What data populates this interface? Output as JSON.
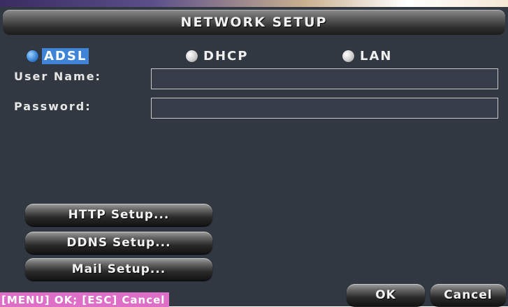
{
  "dialog": {
    "title": "NETWORK SETUP"
  },
  "connection_types": [
    {
      "label": "ADSL",
      "selected": true
    },
    {
      "label": "DHCP",
      "selected": false
    },
    {
      "label": "LAN",
      "selected": false
    }
  ],
  "fields": {
    "username": {
      "label": "User Name:",
      "value": ""
    },
    "password": {
      "label": "Password:",
      "value": ""
    }
  },
  "buttons": {
    "http": "HTTP Setup...",
    "ddns": "DDNS Setup...",
    "mail": "Mail Setup...",
    "ok": "OK",
    "cancel": "Cancel"
  },
  "hint": "[MENU] OK; [ESC] Cancel",
  "colors": {
    "background": "#323842",
    "selected_radio": "#3f84d6",
    "hint_bar": "#de6fc7"
  }
}
